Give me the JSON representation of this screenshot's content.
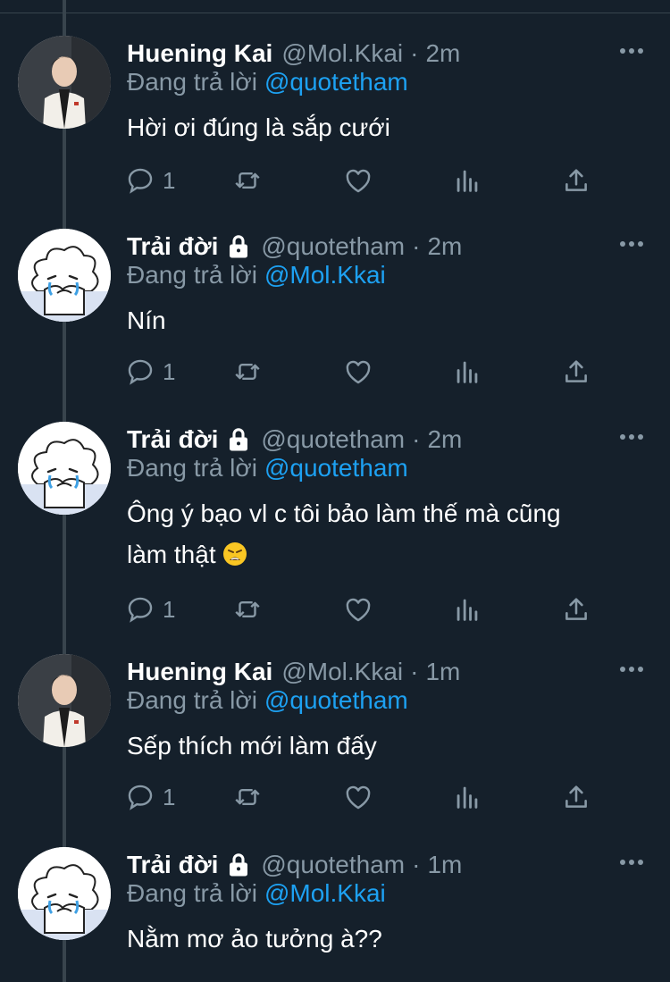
{
  "reply_prefix": "Đang trả lời",
  "tweets": [
    {
      "name": "Huening Kai",
      "handle": "@Mol.Kkai",
      "separator": "·",
      "time": "2m",
      "reply_to": "@quotetham",
      "text": "Hời ơi đúng là sắp cưới",
      "reply_count": "1",
      "avatar": "huening-kai-photo"
    },
    {
      "name": "Trải đời",
      "handle": "@quotetham",
      "separator": "·",
      "time": "2m",
      "reply_to": "@Mol.Kkai",
      "text": "Nín",
      "reply_count": "1",
      "avatar": "crying-cartoon"
    },
    {
      "name": "Trải đời",
      "handle": "@quotetham",
      "separator": "·",
      "time": "2m",
      "reply_to": "@quotetham",
      "text_line1": "Ông ý bạo vl c tôi bảo làm thế mà cũng",
      "text_line2": "làm thật",
      "emoji": "weary-face-emoji",
      "reply_count": "1",
      "avatar": "crying-cartoon"
    },
    {
      "name": "Huening Kai",
      "handle": "@Mol.Kkai",
      "separator": "·",
      "time": "1m",
      "reply_to": "@quotetham",
      "text": "Sếp thích mới làm đấy",
      "reply_count": "1",
      "avatar": "huening-kai-photo"
    },
    {
      "name": "Trải đời",
      "handle": "@quotetham",
      "separator": "·",
      "time": "1m",
      "reply_to": "@Mol.Kkai",
      "text": "Nằm mơ ảo tưởng à??",
      "avatar": "crying-cartoon"
    }
  ],
  "colors": {
    "background": "#15202b",
    "secondary_text": "#8899a6",
    "link": "#1da1f2",
    "thread_line": "#38444d"
  }
}
